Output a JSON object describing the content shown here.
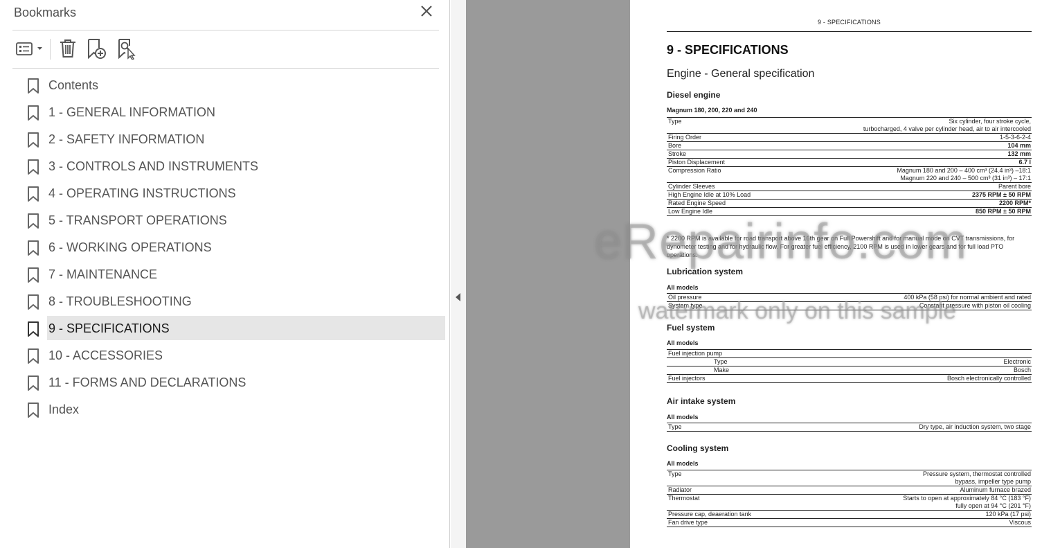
{
  "panel": {
    "title": "Bookmarks",
    "toolbar": {
      "options_icon": "list-options-icon",
      "delete_icon": "trash-icon",
      "new_bookmark_icon": "add-bookmark-icon",
      "find_bookmark_icon": "find-current-bookmark-icon"
    },
    "bookmarks": [
      {
        "label": "Contents",
        "selected": false
      },
      {
        "label": "1 - GENERAL INFORMATION",
        "selected": false
      },
      {
        "label": "2 - SAFETY INFORMATION",
        "selected": false
      },
      {
        "label": "3 - CONTROLS AND INSTRUMENTS",
        "selected": false
      },
      {
        "label": "4 - OPERATING INSTRUCTIONS",
        "selected": false
      },
      {
        "label": "5 - TRANSPORT OPERATIONS",
        "selected": false
      },
      {
        "label": "6 - WORKING OPERATIONS",
        "selected": false
      },
      {
        "label": "7 - MAINTENANCE",
        "selected": false
      },
      {
        "label": "8 - TROUBLESHOOTING",
        "selected": false
      },
      {
        "label": "9 - SPECIFICATIONS",
        "selected": true
      },
      {
        "label": "10 - ACCESSORIES",
        "selected": false
      },
      {
        "label": "11 - FORMS AND DECLARATIONS",
        "selected": false
      },
      {
        "label": "Index",
        "selected": false
      }
    ]
  },
  "document": {
    "running_header": "9 - SPECIFICATIONS",
    "chapter_title": "9 - SPECIFICATIONS",
    "section_title": "Engine - General specification",
    "diesel": {
      "heading": "Diesel engine",
      "subheading": "Magnum 180, 200, 220 and 240",
      "rows": [
        {
          "label": "Type",
          "value": "Six cylinder, four stroke cycle,",
          "bold": false
        },
        {
          "label": "",
          "value": "turbocharged, 4 valve per cylinder head, air to air intercooled",
          "bold": false
        },
        {
          "label": "Firing Order",
          "value": "1-5-3-6-2-4",
          "bold": false
        },
        {
          "label": "Bore",
          "value": "104 mm",
          "bold": true
        },
        {
          "label": "Stroke",
          "value": "132 mm",
          "bold": true
        },
        {
          "label": "Piston Displacement",
          "value": "6.7 l",
          "bold": true
        },
        {
          "label": "Compression Ratio",
          "value": "Magnum 180 and 200 – 400 cm³ (24.4 in³) –18:1",
          "bold": false
        },
        {
          "label": "",
          "value": "Magnum 220 and 240 – 500 cm³ (31 in³) – 17:1",
          "bold": false
        },
        {
          "label": "Cylinder Sleeves",
          "value": "Parent bore",
          "bold": false
        },
        {
          "label": "High Engine Idle at 10% Load",
          "value": "2375 RPM ± 50 RPM",
          "bold": true
        },
        {
          "label": "Rated Engine Speed",
          "value": "2200 RPM*",
          "bold": true
        },
        {
          "label": "Low Engine Idle",
          "value": "850 RPM ± 50 RPM",
          "bold": true
        }
      ],
      "note": "* 2200 RPM is available for road transport above 16th gear on Full Powershift and for manual mode on CVT transmissions, for dynometer testing and for hydraulic flow. For greater fuel efficiency, 2100 RPM is used in lower gears and for full load PTO operations."
    },
    "lubrication": {
      "heading": "Lubrication system",
      "subheading": "All models",
      "rows": [
        {
          "label": "Oil pressure",
          "value": "400 kPa (58 psi) for normal ambient and rated"
        },
        {
          "label": "System type",
          "value": "Constant pressure with piston oil cooling"
        }
      ]
    },
    "fuel": {
      "heading": "Fuel system",
      "subheading": "All models",
      "rows": [
        {
          "label": "Fuel injection pump",
          "value": ""
        },
        {
          "label": "Type",
          "value": "Electronic"
        },
        {
          "label": "Make",
          "value": "Bosch"
        },
        {
          "label": "Fuel injectors",
          "value": "Bosch electronically controlled"
        }
      ]
    },
    "air": {
      "heading": "Air intake system",
      "subheading": "All models",
      "rows": [
        {
          "label": "Type",
          "value": "Dry type, air induction system, two stage"
        }
      ]
    },
    "cooling": {
      "heading": "Cooling system",
      "subheading": "All models",
      "rows": [
        {
          "label": "Type",
          "value": "Pressure system, thermostat controlled"
        },
        {
          "label": "",
          "value": "bypass, impeller type pump"
        },
        {
          "label": "Radiator",
          "value": "Aluminum furnace brazed"
        },
        {
          "label": "Thermostat",
          "value": "Starts to open at approximately 84 °C (183 °F)"
        },
        {
          "label": "",
          "value": "fully open at 94 °C (201 °F)"
        },
        {
          "label": "Pressure cap, deaeration tank",
          "value": "120 kPa (17 psi)"
        },
        {
          "label": "Fan drive type",
          "value": "Viscous"
        }
      ]
    },
    "watermark": {
      "line1": "eRepairinfo.com",
      "line2": "watermark only on this sample"
    }
  }
}
